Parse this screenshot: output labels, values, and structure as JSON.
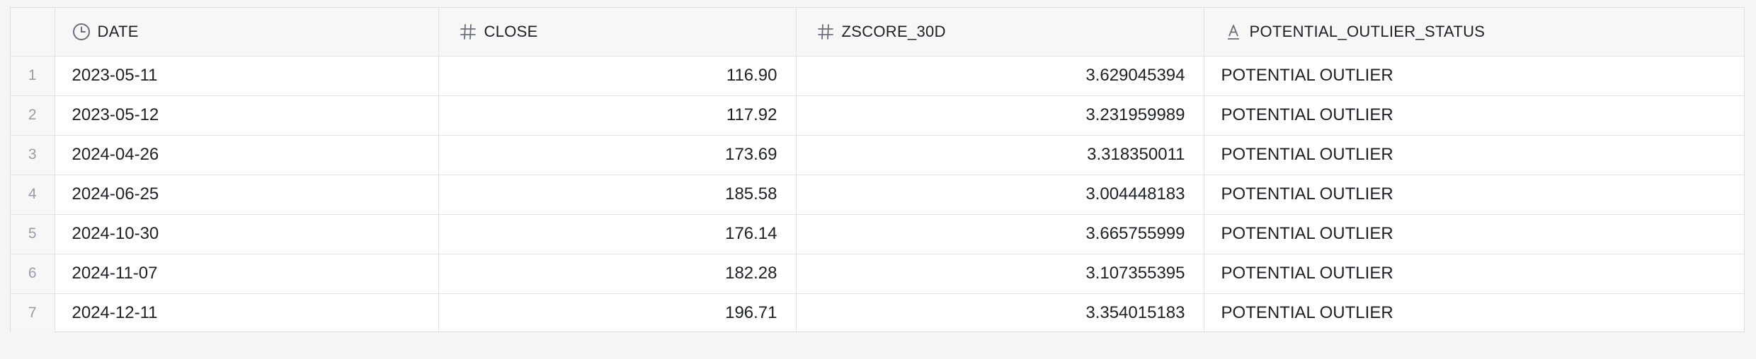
{
  "grid": {
    "columns": [
      {
        "label": "DATE",
        "icon": "clock-icon"
      },
      {
        "label": "CLOSE",
        "icon": "hash-icon"
      },
      {
        "label": "ZSCORE_30D",
        "icon": "hash-icon"
      },
      {
        "label": "POTENTIAL_OUTLIER_STATUS",
        "icon": "text-type-icon"
      }
    ],
    "rows": [
      {
        "index": "1",
        "date": "2023-05-11",
        "close": "116.90",
        "zscore": "3.629045394",
        "status": "POTENTIAL OUTLIER"
      },
      {
        "index": "2",
        "date": "2023-05-12",
        "close": "117.92",
        "zscore": "3.231959989",
        "status": "POTENTIAL OUTLIER"
      },
      {
        "index": "3",
        "date": "2024-04-26",
        "close": "173.69",
        "zscore": "3.318350011",
        "status": "POTENTIAL OUTLIER"
      },
      {
        "index": "4",
        "date": "2024-06-25",
        "close": "185.58",
        "zscore": "3.004448183",
        "status": "POTENTIAL OUTLIER"
      },
      {
        "index": "5",
        "date": "2024-10-30",
        "close": "176.14",
        "zscore": "3.665755999",
        "status": "POTENTIAL OUTLIER"
      },
      {
        "index": "6",
        "date": "2024-11-07",
        "close": "182.28",
        "zscore": "3.107355395",
        "status": "POTENTIAL OUTLIER"
      },
      {
        "index": "7",
        "date": "2024-12-11",
        "close": "196.71",
        "zscore": "3.354015183",
        "status": "POTENTIAL OUTLIER"
      }
    ]
  }
}
